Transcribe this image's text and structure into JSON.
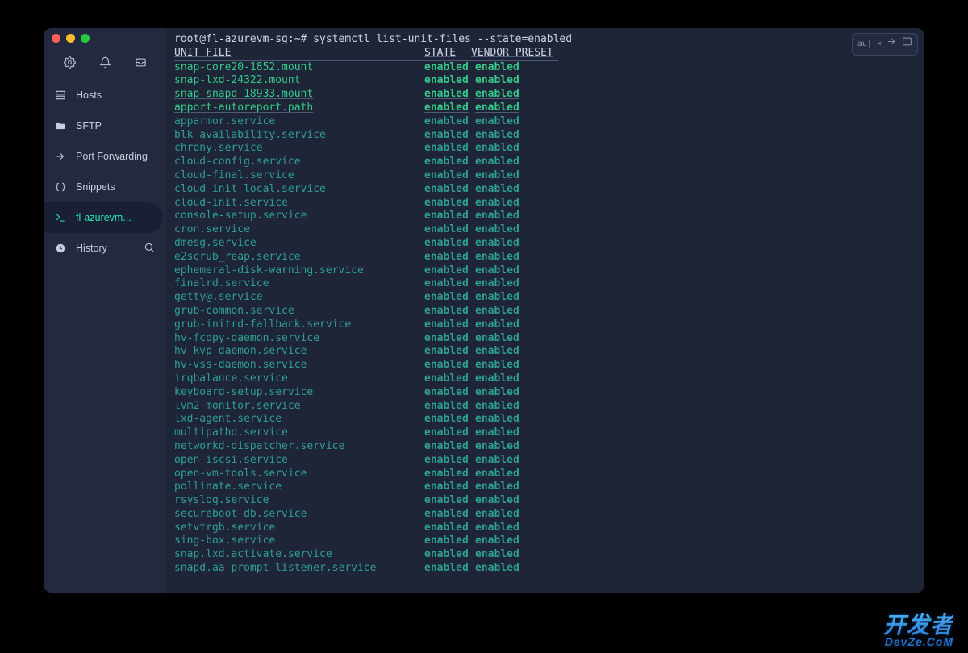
{
  "sidebar": {
    "nav": [
      {
        "id": "hosts",
        "label": "Hosts"
      },
      {
        "id": "sftp",
        "label": "SFTP"
      },
      {
        "id": "port-forwarding",
        "label": "Port Forwarding"
      },
      {
        "id": "snippets",
        "label": "Snippets"
      },
      {
        "id": "session",
        "label": "fl-azurevm..."
      },
      {
        "id": "history",
        "label": "History"
      }
    ]
  },
  "toolbar": {
    "badge": "au| ×"
  },
  "terminal": {
    "prompt": "root@fl-azurevm-sg:~# systemctl list-unit-files --state=enabled",
    "header": {
      "col1": "UNIT FILE",
      "col2": "STATE",
      "col3": "VENDOR PRESET"
    },
    "rows": [
      {
        "unit": "snap-core20-1852.mount",
        "state": "enabled",
        "preset": "enabled",
        "color": "green",
        "ul": false
      },
      {
        "unit": "snap-lxd-24322.mount",
        "state": "enabled",
        "preset": "enabled",
        "color": "green",
        "ul": false
      },
      {
        "unit": "snap-snapd-18933.mount",
        "state": "enabled",
        "preset": "enabled",
        "color": "green",
        "ul": true
      },
      {
        "unit": "apport-autoreport.path",
        "state": "enabled",
        "preset": "enabled",
        "color": "green",
        "ul": true
      },
      {
        "unit": "apparmor.service",
        "state": "enabled",
        "preset": "enabled",
        "color": "teal",
        "ul": false
      },
      {
        "unit": "blk-availability.service",
        "state": "enabled",
        "preset": "enabled",
        "color": "teal",
        "ul": false
      },
      {
        "unit": "chrony.service",
        "state": "enabled",
        "preset": "enabled",
        "color": "teal",
        "ul": false
      },
      {
        "unit": "cloud-config.service",
        "state": "enabled",
        "preset": "enabled",
        "color": "teal",
        "ul": false
      },
      {
        "unit": "cloud-final.service",
        "state": "enabled",
        "preset": "enabled",
        "color": "teal",
        "ul": false
      },
      {
        "unit": "cloud-init-local.service",
        "state": "enabled",
        "preset": "enabled",
        "color": "teal",
        "ul": false
      },
      {
        "unit": "cloud-init.service",
        "state": "enabled",
        "preset": "enabled",
        "color": "teal",
        "ul": false
      },
      {
        "unit": "console-setup.service",
        "state": "enabled",
        "preset": "enabled",
        "color": "teal",
        "ul": false
      },
      {
        "unit": "cron.service",
        "state": "enabled",
        "preset": "enabled",
        "color": "teal",
        "ul": false
      },
      {
        "unit": "dmesg.service",
        "state": "enabled",
        "preset": "enabled",
        "color": "teal",
        "ul": false
      },
      {
        "unit": "e2scrub_reap.service",
        "state": "enabled",
        "preset": "enabled",
        "color": "teal",
        "ul": false
      },
      {
        "unit": "ephemeral-disk-warning.service",
        "state": "enabled",
        "preset": "enabled",
        "color": "teal",
        "ul": false
      },
      {
        "unit": "finalrd.service",
        "state": "enabled",
        "preset": "enabled",
        "color": "teal",
        "ul": false
      },
      {
        "unit": "getty@.service",
        "state": "enabled",
        "preset": "enabled",
        "color": "teal",
        "ul": false
      },
      {
        "unit": "grub-common.service",
        "state": "enabled",
        "preset": "enabled",
        "color": "teal",
        "ul": false
      },
      {
        "unit": "grub-initrd-fallback.service",
        "state": "enabled",
        "preset": "enabled",
        "color": "teal",
        "ul": false
      },
      {
        "unit": "hv-fcopy-daemon.service",
        "state": "enabled",
        "preset": "enabled",
        "color": "teal",
        "ul": false
      },
      {
        "unit": "hv-kvp-daemon.service",
        "state": "enabled",
        "preset": "enabled",
        "color": "teal",
        "ul": false
      },
      {
        "unit": "hv-vss-daemon.service",
        "state": "enabled",
        "preset": "enabled",
        "color": "teal",
        "ul": false
      },
      {
        "unit": "irqbalance.service",
        "state": "enabled",
        "preset": "enabled",
        "color": "teal",
        "ul": false
      },
      {
        "unit": "keyboard-setup.service",
        "state": "enabled",
        "preset": "enabled",
        "color": "teal",
        "ul": false
      },
      {
        "unit": "lvm2-monitor.service",
        "state": "enabled",
        "preset": "enabled",
        "color": "teal",
        "ul": false
      },
      {
        "unit": "lxd-agent.service",
        "state": "enabled",
        "preset": "enabled",
        "color": "teal",
        "ul": false
      },
      {
        "unit": "multipathd.service",
        "state": "enabled",
        "preset": "enabled",
        "color": "teal",
        "ul": false
      },
      {
        "unit": "networkd-dispatcher.service",
        "state": "enabled",
        "preset": "enabled",
        "color": "teal",
        "ul": false
      },
      {
        "unit": "open-iscsi.service",
        "state": "enabled",
        "preset": "enabled",
        "color": "teal",
        "ul": false
      },
      {
        "unit": "open-vm-tools.service",
        "state": "enabled",
        "preset": "enabled",
        "color": "teal",
        "ul": false
      },
      {
        "unit": "pollinate.service",
        "state": "enabled",
        "preset": "enabled",
        "color": "teal",
        "ul": false
      },
      {
        "unit": "rsyslog.service",
        "state": "enabled",
        "preset": "enabled",
        "color": "teal",
        "ul": false
      },
      {
        "unit": "secureboot-db.service",
        "state": "enabled",
        "preset": "enabled",
        "color": "teal",
        "ul": false
      },
      {
        "unit": "setvtrgb.service",
        "state": "enabled",
        "preset": "enabled",
        "color": "teal",
        "ul": false
      },
      {
        "unit": "sing-box.service",
        "state": "enabled",
        "preset": "enabled",
        "color": "teal",
        "ul": false
      },
      {
        "unit": "snap.lxd.activate.service",
        "state": "enabled",
        "preset": "enabled",
        "color": "teal",
        "ul": false
      },
      {
        "unit": "snapd.aa-prompt-listener.service",
        "state": "enabled",
        "preset": "enabled",
        "color": "teal",
        "ul": false
      }
    ]
  },
  "watermark": {
    "line1": "开发者",
    "line2": "DevZe.CoM"
  }
}
